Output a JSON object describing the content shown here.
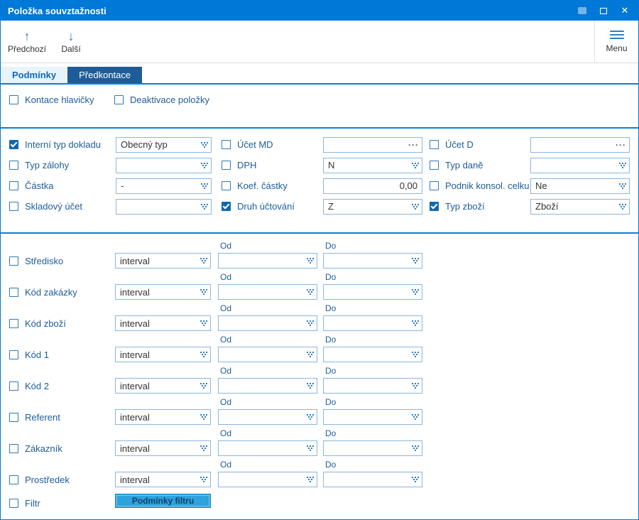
{
  "window": {
    "title": "Položka souvztažnosti"
  },
  "toolbar": {
    "prev_label": "Předchozí",
    "next_label": "Další",
    "menu_label": "Menu"
  },
  "tabs": [
    {
      "label": "Podmínky",
      "active": true
    },
    {
      "label": "Předkontace",
      "active": false
    }
  ],
  "header_checks": [
    {
      "label": "Kontace hlavičky",
      "checked": false
    },
    {
      "label": "Deaktivace položky",
      "checked": false
    }
  ],
  "fields": [
    {
      "label": "Interní typ dokladu",
      "checked": true,
      "type": "combo",
      "value": "Obecný typ"
    },
    {
      "label": "Účet MD",
      "checked": false,
      "type": "picker",
      "value": ""
    },
    {
      "label": "Účet D",
      "checked": false,
      "type": "picker",
      "value": ""
    },
    {
      "label": "Typ zálohy",
      "checked": false,
      "type": "combo",
      "value": ""
    },
    {
      "label": "DPH",
      "checked": false,
      "type": "combo",
      "value": "N"
    },
    {
      "label": "Typ daně",
      "checked": false,
      "type": "combo",
      "value": ""
    },
    {
      "label": "Částka",
      "checked": false,
      "type": "combo",
      "value": "-"
    },
    {
      "label": "Koef. částky",
      "checked": false,
      "type": "number",
      "value": "0,00"
    },
    {
      "label": "Podnik konsol. celku",
      "checked": false,
      "type": "combo",
      "value": "Ne"
    },
    {
      "label": "Skladový účet",
      "checked": false,
      "type": "combo",
      "value": ""
    },
    {
      "label": "Druh účtování",
      "checked": true,
      "type": "combo",
      "value": "Z"
    },
    {
      "label": "Typ zboží",
      "checked": true,
      "type": "combo",
      "value": "Zboží"
    }
  ],
  "ranges": {
    "od_label": "Od",
    "do_label": "Do",
    "rows": [
      {
        "label": "Středisko",
        "checked": false,
        "mode": "interval",
        "od": "",
        "do": ""
      },
      {
        "label": "Kód zakázky",
        "checked": false,
        "mode": "interval",
        "od": "",
        "do": ""
      },
      {
        "label": "Kód zboží",
        "checked": false,
        "mode": "interval",
        "od": "",
        "do": ""
      },
      {
        "label": "Kód 1",
        "checked": false,
        "mode": "interval",
        "od": "",
        "do": ""
      },
      {
        "label": "Kód 2",
        "checked": false,
        "mode": "interval",
        "od": "",
        "do": ""
      },
      {
        "label": "Referent",
        "checked": false,
        "mode": "interval",
        "od": "",
        "do": ""
      },
      {
        "label": "Zákazník",
        "checked": false,
        "mode": "interval",
        "od": "",
        "do": ""
      },
      {
        "label": "Prostředek",
        "checked": false,
        "mode": "interval",
        "od": "",
        "do": ""
      }
    ]
  },
  "filter": {
    "label": "Filtr",
    "checked": false,
    "button_label": "Podmínky filtru"
  },
  "icons": {
    "arrow_up": "↑",
    "arrow_down": "↓",
    "close": "✕",
    "ellipsis": "···"
  },
  "colors": {
    "titlebar": "#0078d7",
    "accent_line": "#0084d8",
    "label_text": "#1d5c99",
    "tab_inactive_bg": "#1d5c99",
    "checkbox_checked": "#1168ac",
    "control_border": "#8ab6dd",
    "filter_button_bg": "#2ea2da"
  }
}
